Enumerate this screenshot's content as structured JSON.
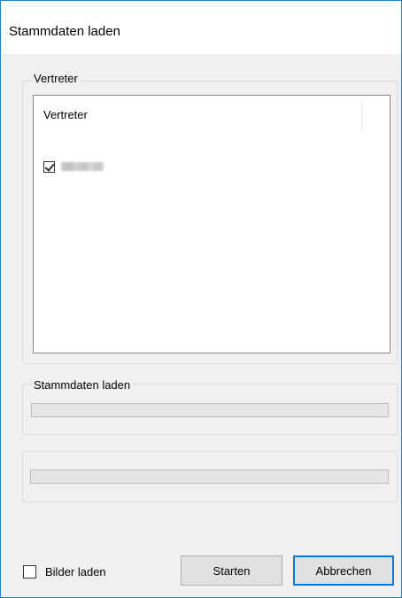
{
  "window": {
    "title": "Stammdaten laden"
  },
  "vertreter_group": {
    "legend": "Vertreter",
    "list": {
      "column_header": "Vertreter",
      "items": [
        {
          "checked": true,
          "label_blurred": true
        }
      ]
    }
  },
  "stammdaten_group": {
    "legend": "Stammdaten laden",
    "progress": 0
  },
  "second_group": {
    "progress": 0
  },
  "bottom": {
    "bilder_label": "Bilder laden",
    "bilder_checked": false,
    "start_label": "Starten",
    "cancel_label": "Abbrechen"
  },
  "colors": {
    "accent": "#0078d7",
    "window_border": "#1883d7",
    "panel": "#f0f0f0"
  }
}
